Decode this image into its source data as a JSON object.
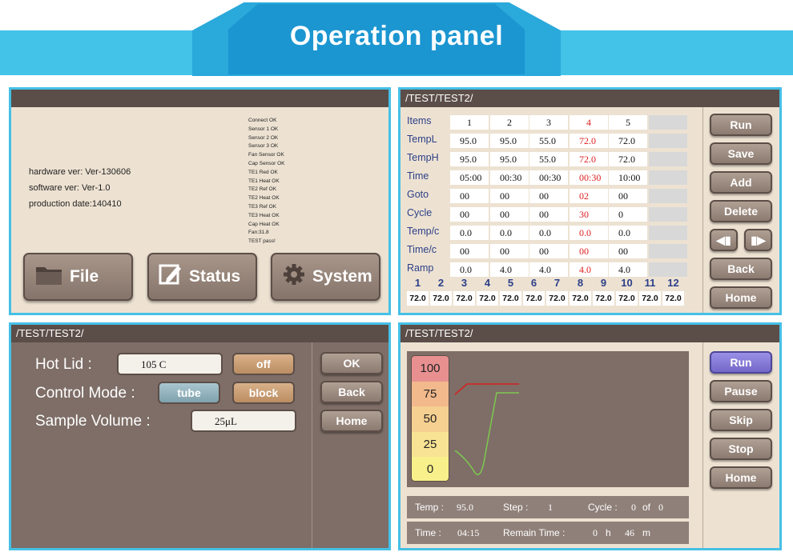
{
  "banner": {
    "title": "Operation panel"
  },
  "p1": {
    "hardware": "hardware ver: Ver-130606",
    "software": "software ver: Ver-1.0",
    "production": "production date:140410",
    "status_lines": [
      "Connect OK",
      "Sensor 1 OK",
      "Sensor 2 OK",
      "Sensor 3 OK",
      "Fan Sensor  OK",
      "Cap Sensor OK",
      "TE1 Red OK",
      "TE1 Heat OK",
      "TE2 Ref OK",
      "TE2 Heat OK",
      "TE3 Ref OK",
      "TE3 Heat OK",
      "Cap Heat OK",
      "Fan:31.8",
      "TEST pass!"
    ],
    "buttons": {
      "file": "File",
      "status": "Status",
      "system": "System"
    }
  },
  "p2": {
    "path": "/TEST/TEST2/",
    "headers": [
      "1",
      "2",
      "3",
      "4",
      "5"
    ],
    "rows": [
      {
        "label": "TempL",
        "values": [
          "95.0",
          "95.0",
          "55.0",
          "72.0",
          "72.0"
        ]
      },
      {
        "label": "TempH",
        "values": [
          "95.0",
          "95.0",
          "55.0",
          "72.0",
          "72.0"
        ]
      },
      {
        "label": "Time",
        "values": [
          "05:00",
          "00:30",
          "00:30",
          "00:30",
          "10:00"
        ]
      },
      {
        "label": "Goto",
        "values": [
          "00",
          "00",
          "00",
          "02",
          "00"
        ]
      },
      {
        "label": "Cycle",
        "values": [
          "00",
          "00",
          "00",
          "30",
          "0"
        ]
      },
      {
        "label": "Temp/c",
        "values": [
          "0.0",
          "0.0",
          "0.0",
          "0.0",
          "0.0"
        ]
      },
      {
        "label": "Time/c",
        "values": [
          "00",
          "00",
          "00",
          "00",
          "00"
        ]
      },
      {
        "label": "Ramp",
        "values": [
          "0.0",
          "4.0",
          "4.0",
          "4.0",
          "4.0"
        ]
      }
    ],
    "items_label": "Items",
    "highlight_col": 3,
    "blocks": {
      "numbers": [
        "1",
        "2",
        "3",
        "4",
        "5",
        "6",
        "7",
        "8",
        "9",
        "10",
        "11",
        "12"
      ],
      "values": [
        "72.0",
        "72.0",
        "72.0",
        "72.0",
        "72.0",
        "72.0",
        "72.0",
        "72.0",
        "72.0",
        "72.0",
        "72.0",
        "72.0"
      ]
    },
    "buttons": {
      "run": "Run",
      "save": "Save",
      "add": "Add",
      "delete": "Delete",
      "back": "Back",
      "home": "Home"
    }
  },
  "p3": {
    "path": "/TEST/TEST2/",
    "hot_lid_label": "Hot Lid :",
    "hot_lid_value": "105 C",
    "off_label": "off",
    "control_mode_label": "Control Mode :",
    "tube_label": "tube",
    "block_label": "block",
    "sample_volume_label": "Sample Volume :",
    "sample_volume_value": "25μL",
    "buttons": {
      "ok": "OK",
      "back": "Back",
      "home": "Home"
    }
  },
  "p4": {
    "path": "/TEST/TEST2/",
    "scale": [
      "100",
      "75",
      "50",
      "25",
      "0"
    ],
    "temp_label": "Temp :",
    "temp_value": "95.0",
    "step_label": "Step :",
    "step_value": "1",
    "cycle_label": "Cycle :",
    "cycle_value": "0",
    "of_label": "of",
    "of_value": "0",
    "time_label": "Time :",
    "time_value": "04:15",
    "remain_label": "Remain Time :",
    "remain_h": "0",
    "h_label": "h",
    "remain_m": "46",
    "m_label": "m",
    "buttons": {
      "run": "Run",
      "pause": "Pause",
      "skip": "Skip",
      "stop": "Stop",
      "home": "Home"
    },
    "colors": {
      "red_line": "#d62020",
      "green_line": "#7ec850",
      "run_button": "#8b80d8"
    }
  }
}
